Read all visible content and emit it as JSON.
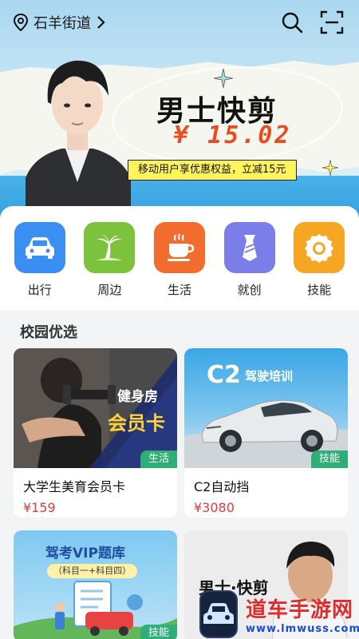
{
  "header": {
    "location": "石羊街道",
    "icons": [
      "location-pin-icon",
      "chevron-right-icon",
      "search-icon",
      "scan-icon"
    ]
  },
  "banner": {
    "title": "男士快剪",
    "price": "¥ 15.02",
    "tag": "移动用户享优惠权益，立减15元"
  },
  "services": [
    {
      "label": "出行",
      "icon": "car-icon",
      "color": "#3b8ef2"
    },
    {
      "label": "周边",
      "icon": "palm-tree-icon",
      "color": "#7cc23c"
    },
    {
      "label": "生活",
      "icon": "coffee-cup-icon",
      "color": "#f26d2d"
    },
    {
      "label": "就创",
      "icon": "tie-icon",
      "color": "#7b7de8"
    },
    {
      "label": "技能",
      "icon": "badge-icon",
      "color": "#f5a623"
    }
  ],
  "section": {
    "title": "校园优选"
  },
  "products": [
    {
      "name": "大学生美育会员卡",
      "price": "¥159",
      "category": "生活",
      "img_text1": "健身房",
      "img_text2": "会员卡"
    },
    {
      "name": "C2自动挡",
      "price": "¥3080",
      "category": "技能",
      "img_text1": "C2",
      "img_text2": "驾驶培训"
    },
    {
      "name": "",
      "price": "",
      "category": "技能",
      "img_text1": "驾考VIP题库",
      "img_text2": "（科目一+科目四）"
    },
    {
      "name": "",
      "price": "",
      "category": "",
      "img_text1": "男士·快剪",
      "img_text2": ""
    }
  ],
  "watermark": {
    "line1": "道车手游网",
    "line2": "www.lmwuss.com"
  }
}
